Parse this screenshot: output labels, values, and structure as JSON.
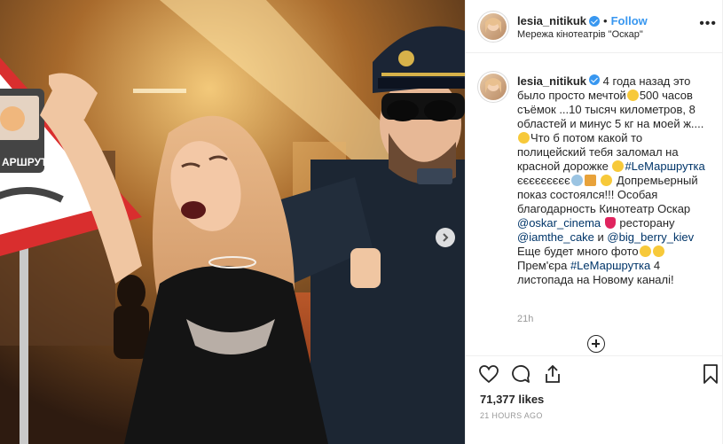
{
  "post": {
    "username": "lesia_nitikuk",
    "separator": "•",
    "follow_label": "Follow",
    "location": "Мережа кінотеатрів \"Оскар\"",
    "more_label": "•••"
  },
  "caption": {
    "username": "lesia_nitikuk",
    "line1": "4 года назад это было просто мечтой",
    "line2": "500 часов съёмок ...10 тысяч километров, 8 областей и минус 5 кг на моей ж.... ",
    "line3": "Что б потом какой то полицейский тебя заломал на красной дорожке ",
    "hashtag1": "#LеМаршрутка",
    "line4": " єєєєєєєєє",
    "line5": " Допремьерный показ состоялся!!! Особая благодарность Кинотеатр Оскар ",
    "mention1": "@oskar_cinema",
    "line6": " ресторану ",
    "mention2": "@iamthe_cake",
    "line7": " и ",
    "mention3": "@big_berry_kiev",
    "line8": " Еще будет много фото",
    "line9": " Прем'єра ",
    "hashtag2": "#LеМаршрутка",
    "line10": " 4 листопада на Новому каналі!",
    "time_ago": "21h"
  },
  "icons": {
    "like": "heart-icon",
    "comment": "comment-icon",
    "share": "share-icon",
    "save": "bookmark-icon",
    "next": "chevron-right-icon",
    "load_more": "plus-circle-icon"
  },
  "stats": {
    "likes": "71,377 likes",
    "posted": "21 HOURS AGO"
  },
  "photo": {
    "sign_text": "АРШРУТКА"
  },
  "colors": {
    "accent": "#3897f0",
    "hashtag": "#003569",
    "muted": "#999999"
  }
}
